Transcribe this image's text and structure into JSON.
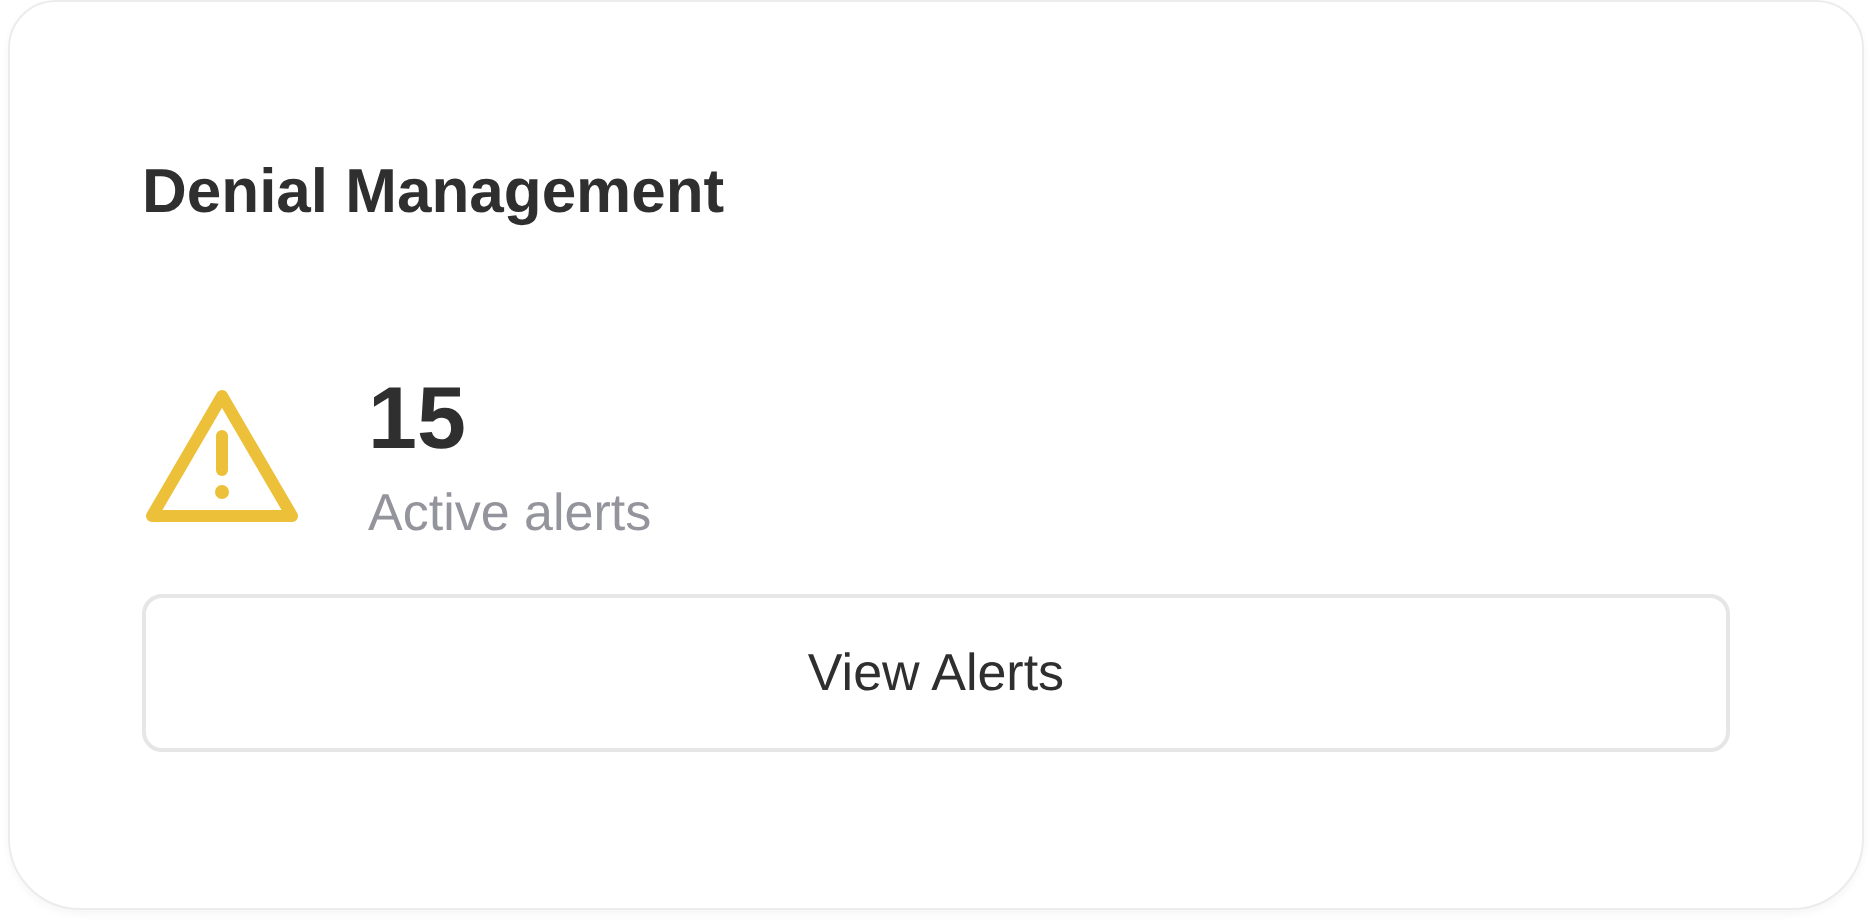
{
  "card": {
    "title": "Denial Management",
    "count": "15",
    "count_label": "Active alerts",
    "button": "View Alerts"
  }
}
